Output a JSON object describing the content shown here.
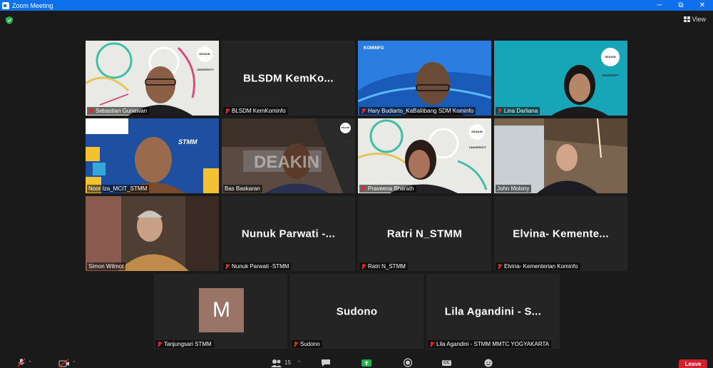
{
  "window": {
    "title": "Zoom Meeting",
    "minimize": "─",
    "maximize": "⧉",
    "close": "✕"
  },
  "view_label": "View",
  "participants_count": "15",
  "leave_label": "Leave",
  "cc_label": "CC",
  "colors": {
    "titlebar": "#0e71eb",
    "active_speaker": "#e6e34a",
    "muted": "#e02828",
    "leave": "#d4202a",
    "avatar_m": "#9b7468"
  },
  "tiles": [
    {
      "name": "Sebastian Gunawan",
      "muted": true,
      "video": true
    },
    {
      "name": "BLSDM KemKominfo",
      "big": "BLSDM  KemKo...",
      "muted": true,
      "video": false
    },
    {
      "name": "Hary Budiarto_KaBalitbang SDM Kominfo",
      "muted": true,
      "video": true
    },
    {
      "name": "Lina Darliana",
      "muted": true,
      "video": true
    },
    {
      "name": "Noor Iza_MCIT_STMM",
      "muted": false,
      "video": true
    },
    {
      "name": "Bas Baskaran",
      "muted": false,
      "video": true,
      "active": true
    },
    {
      "name": "Praveena Bharath",
      "muted": true,
      "video": true
    },
    {
      "name": "John Molony",
      "muted": false,
      "video": true
    },
    {
      "name": "Simon Wilmot",
      "muted": false,
      "video": true
    },
    {
      "name": "Nunuk Parwati -STMM",
      "big": "Nunuk  Parwati  -...",
      "muted": true,
      "video": false
    },
    {
      "name": "Ratri N_STMM",
      "big": "Ratri N_STMM",
      "muted": true,
      "video": false
    },
    {
      "name": "Elvina- Kementerian Kominfo",
      "big": "Elvina-  Kemente...",
      "muted": true,
      "video": false
    },
    {
      "name": "Tanjungsari STMM",
      "avatar": "M",
      "muted": true,
      "video": false
    },
    {
      "name": "Sudono",
      "big": "Sudono",
      "muted": true,
      "video": false
    },
    {
      "name": "Lila Agandini - STMM MMTC YOGYAKARTA",
      "big": "Lila  Agandini  -  S...",
      "muted": true,
      "video": false
    }
  ],
  "logos": {
    "deakin": "DEAKIN UNIVERSITY",
    "kominfo": "KOMINFO",
    "stmm": "STMM",
    "deakin_bg": "DEAKIN"
  }
}
